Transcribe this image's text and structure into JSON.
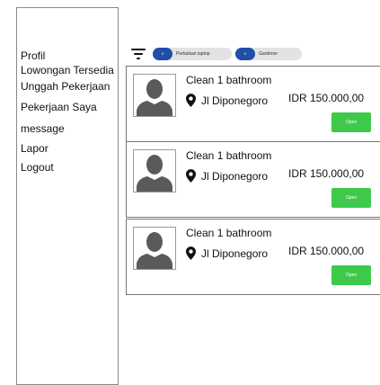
{
  "sidebar": {
    "items": [
      {
        "label": "Profil"
      },
      {
        "label": "Lowongan Tersedia"
      },
      {
        "label": "Unggah Pekerjaan"
      },
      {
        "label": "Pekerjaan Saya"
      },
      {
        "label": "message"
      },
      {
        "label": "Lapor"
      },
      {
        "label": "Logout"
      }
    ]
  },
  "filters": {
    "icon": "filter-icon",
    "chips": [
      {
        "badge": "X",
        "label": "Perbaikan laptop"
      },
      {
        "badge": "X",
        "label": "Gardener"
      }
    ]
  },
  "jobs": [
    {
      "title": "Clean 1 bathroom",
      "location": "Jl Diponegoro",
      "price": "IDR 150.000,00",
      "action": "Open"
    },
    {
      "title": "Clean 1 bathroom",
      "location": "Jl Diponegoro",
      "price": "IDR 150.000,00",
      "action": "Open"
    },
    {
      "title": "Clean 1 bathroom",
      "location": "Jl Diponegoro",
      "price": "IDR 150.000,00",
      "action": "Open"
    }
  ],
  "colors": {
    "chip_badge": "#1f4fa8",
    "chip_background": "#e3e3e3",
    "open_button": "#3ec94a",
    "avatar_silhouette": "#5a5a5a"
  }
}
